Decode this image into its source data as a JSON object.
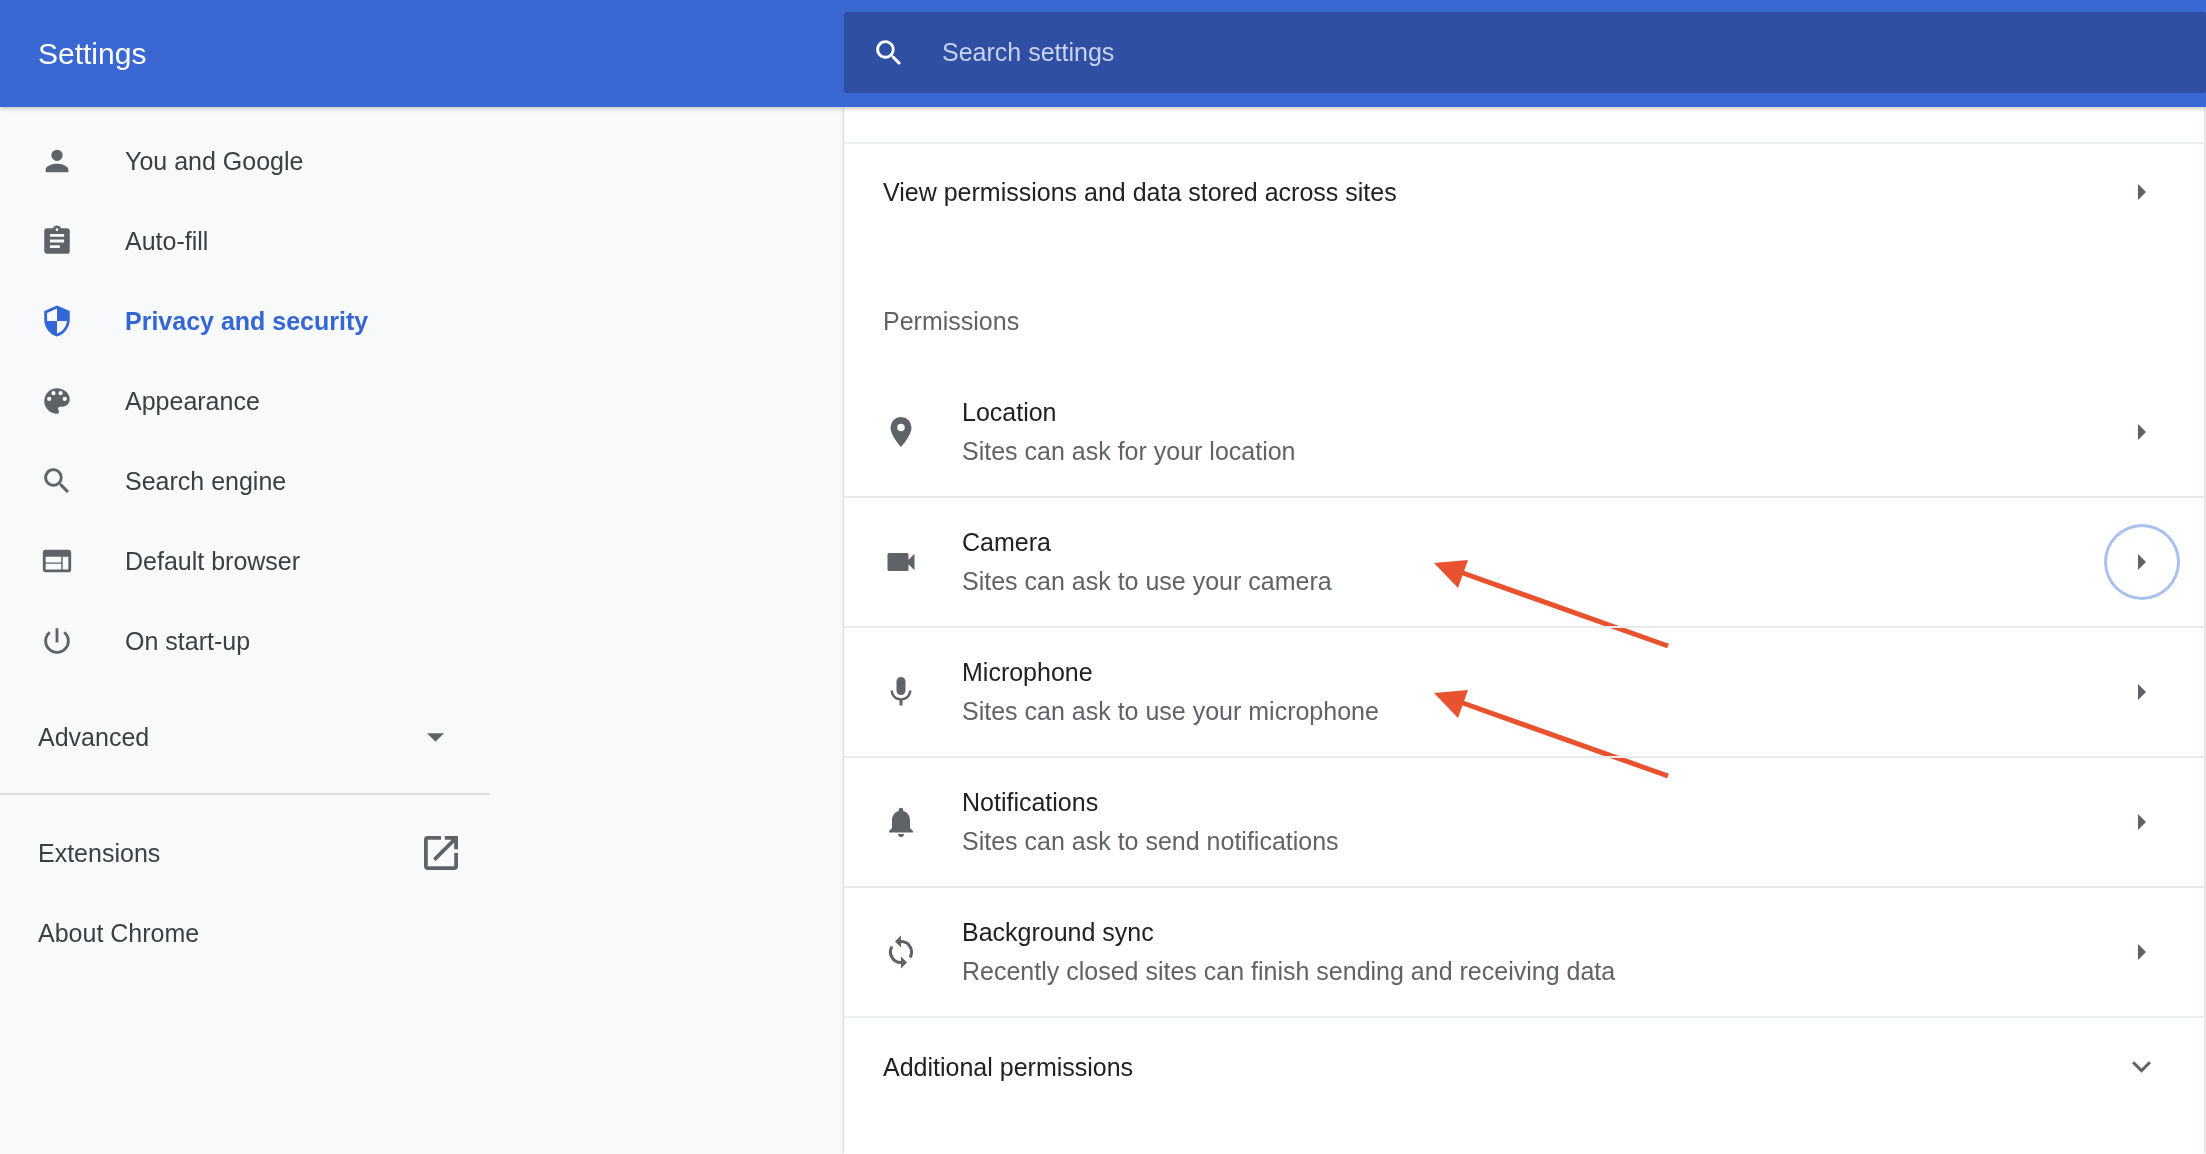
{
  "header": {
    "title": "Settings",
    "search": {
      "placeholder": "Search settings"
    }
  },
  "sidebar": {
    "items": [
      {
        "label": "You and Google",
        "selected": false
      },
      {
        "label": "Auto-fill",
        "selected": false
      },
      {
        "label": "Privacy and security",
        "selected": true
      },
      {
        "label": "Appearance",
        "selected": false
      },
      {
        "label": "Search engine",
        "selected": false
      },
      {
        "label": "Default browser",
        "selected": false
      },
      {
        "label": "On start-up",
        "selected": false
      }
    ],
    "advanced": {
      "label": "Advanced",
      "expanded": false
    },
    "links": [
      {
        "label": "Extensions",
        "external": true
      },
      {
        "label": "About Chrome",
        "external": false
      }
    ]
  },
  "content": {
    "top_link": {
      "label": "View permissions and data stored across sites"
    },
    "section_title": "Permissions",
    "permissions": [
      {
        "title": "Location",
        "subtitle": "Sites can ask for your location",
        "focused": false,
        "arrow": false
      },
      {
        "title": "Camera",
        "subtitle": "Sites can ask to use your camera",
        "focused": true,
        "arrow": true
      },
      {
        "title": "Microphone",
        "subtitle": "Sites can ask to use your microphone",
        "focused": false,
        "arrow": true
      },
      {
        "title": "Notifications",
        "subtitle": "Sites can ask to send notifications",
        "focused": false,
        "arrow": false
      },
      {
        "title": "Background sync",
        "subtitle": "Recently closed sites can finish sending and receiving data",
        "focused": false,
        "arrow": false
      }
    ],
    "additional": {
      "label": "Additional permissions",
      "expanded": false
    }
  }
}
